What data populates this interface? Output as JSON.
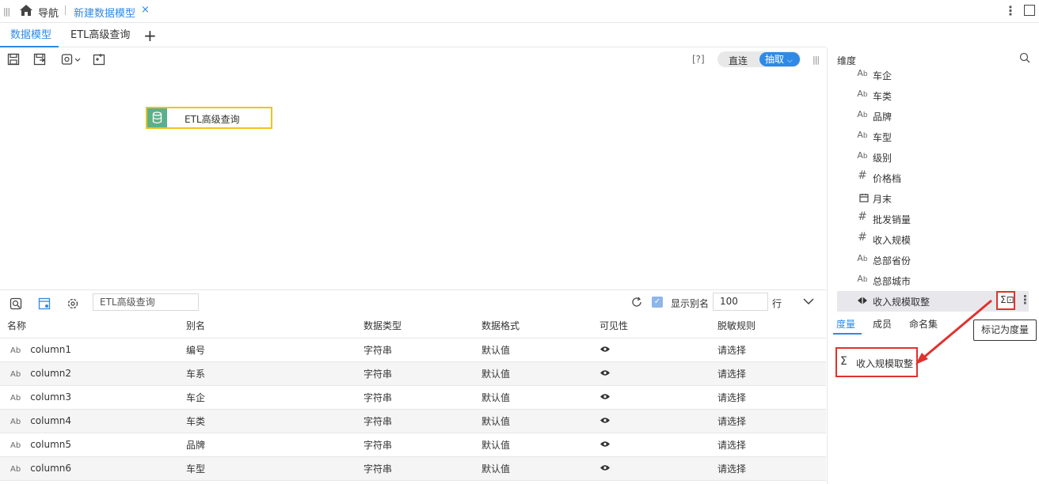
{
  "topbar": {
    "nav_label": "导航",
    "active_tab": "新建数据模型",
    "close_glyph": "×"
  },
  "subtabs": [
    {
      "label": "数据模型",
      "active": true
    },
    {
      "label": "ETL高级查询",
      "active": false
    }
  ],
  "toolbar": {
    "help": "[?]",
    "mode_direct": "直连",
    "mode_extract": "抽取"
  },
  "canvas": {
    "node_label": "ETL高级查询"
  },
  "gridbar": {
    "search_value": "ETL高级查询",
    "show_alias_label": "显示别名",
    "show_alias_checked": true,
    "rows_value": "100",
    "rows_unit": "行"
  },
  "grid": {
    "headers": [
      "名称",
      "别名",
      "数据类型",
      "数据格式",
      "可见性",
      "脱敏规则"
    ],
    "rows": [
      {
        "name": "column1",
        "alias": "编号",
        "type": "字符串",
        "format": "默认值",
        "mask": "请选择"
      },
      {
        "name": "column2",
        "alias": "车系",
        "type": "字符串",
        "format": "默认值",
        "mask": "请选择"
      },
      {
        "name": "column3",
        "alias": "车企",
        "type": "字符串",
        "format": "默认值",
        "mask": "请选择"
      },
      {
        "name": "column4",
        "alias": "车类",
        "type": "字符串",
        "format": "默认值",
        "mask": "请选择"
      },
      {
        "name": "column5",
        "alias": "品牌",
        "type": "字符串",
        "format": "默认值",
        "mask": "请选择"
      },
      {
        "name": "column6",
        "alias": "车型",
        "type": "字符串",
        "format": "默认值",
        "mask": "请选择"
      }
    ]
  },
  "right_panel": {
    "title": "维度",
    "dimensions": [
      {
        "icon": "Ab",
        "label": "车企"
      },
      {
        "icon": "Ab",
        "label": "车类"
      },
      {
        "icon": "Ab",
        "label": "品牌"
      },
      {
        "icon": "Ab",
        "label": "车型"
      },
      {
        "icon": "Ab",
        "label": "级别"
      },
      {
        "icon": "#",
        "label": "价格档"
      },
      {
        "icon": "calendar",
        "label": "月末"
      },
      {
        "icon": "#",
        "label": "批发销量"
      },
      {
        "icon": "#",
        "label": "收入规模"
      },
      {
        "icon": "Ab",
        "label": "总部省份"
      },
      {
        "icon": "Ab",
        "label": "总部城市"
      },
      {
        "icon": "calc",
        "label": "收入规模取整"
      }
    ],
    "tabs": [
      "度量",
      "成员",
      "命名集"
    ],
    "tooltip": "标记为度量",
    "measure_item": "收入规模取整",
    "accent_color": "#2e8ae6",
    "highlight_color": "#e0322e"
  }
}
